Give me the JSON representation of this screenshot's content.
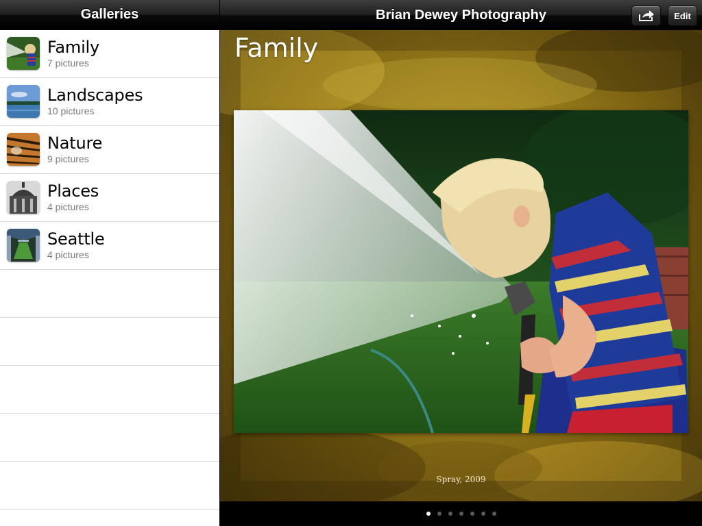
{
  "sidebar": {
    "title": "Galleries",
    "items": [
      {
        "label": "Family",
        "count": "7 pictures",
        "thumb_icon": "family-thumbnail"
      },
      {
        "label": "Landscapes",
        "count": "10 pictures",
        "thumb_icon": "landscape-thumbnail"
      },
      {
        "label": "Nature",
        "count": "9 pictures",
        "thumb_icon": "tiger-thumbnail"
      },
      {
        "label": "Places",
        "count": "4 pictures",
        "thumb_icon": "building-thumbnail"
      },
      {
        "label": "Seattle",
        "count": "4 pictures",
        "thumb_icon": "arches-thumbnail"
      }
    ]
  },
  "header": {
    "title": "Brian Dewey Photography",
    "share_icon": "share-icon",
    "edit_label": "Edit"
  },
  "main": {
    "heading": "Family",
    "caption": "Spray, 2009",
    "photo_subject": "child-spraying-water-hose-photo"
  },
  "pager": {
    "total_pages": 7,
    "current_page": 1
  },
  "colors": {
    "bar_dark": "#000000",
    "canvas_gold": "#a1841f",
    "list_separator": "#d9d9d9",
    "subtitle_gray": "#7a7a7a"
  }
}
